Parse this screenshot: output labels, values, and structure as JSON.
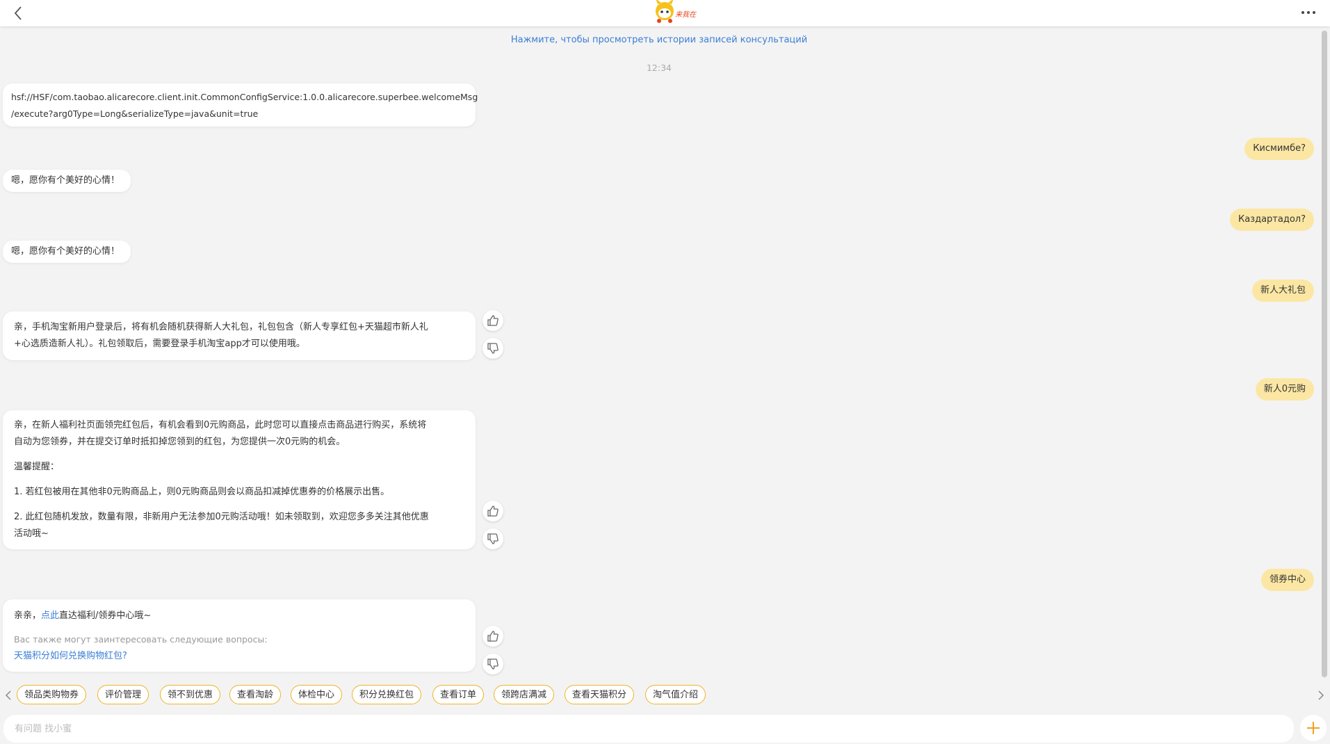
{
  "header": {
    "back_icon": "chevron-left-icon",
    "logo_text": "来我在",
    "more_icon": "more-horizontal-icon"
  },
  "chat": {
    "history_link": "Нажмите, чтобы просмотреть истории записей консультаций",
    "timestamp": "12:34",
    "messages": [
      {
        "from": "bot",
        "lines": [
          "hsf://HSF/com.taobao.alicarecore.client.init.CommonConfigService:1.0.0.alicarecore.superbee.welcomeMsg",
          "/execute?arg0Type=Long&serializeType=java&unit=true"
        ]
      },
      {
        "from": "user",
        "text": "Кисмимбе?"
      },
      {
        "from": "bot",
        "text": "嗯，愿你有个美好的心情！"
      },
      {
        "from": "user",
        "text": "Каздартадол?"
      },
      {
        "from": "bot",
        "text": "嗯，愿你有个美好的心情！"
      },
      {
        "from": "user",
        "text": "新人大礼包"
      },
      {
        "from": "bot",
        "lines": [
          "亲，手机淘宝新用户登录后，将有机会随机获得新人大礼包，礼包包含（新人专享红包+天猫超市新人礼",
          "+心选质造新人礼）。礼包领取后，需要登录手机淘宝app才可以使用哦。"
        ]
      },
      {
        "from": "user",
        "text": "新人0元购"
      },
      {
        "from": "bot",
        "para1": [
          "亲，在新人福利社页面领完红包后，有机会看到0元购商品，此时您可以直接点击商品进行购买，系统将",
          "自动为您领券，并在提交订单时抵扣掉您领到的红包，为您提供一次0元购的机会。"
        ],
        "para2": "温馨提醒：",
        "para3": "1. 若红包被用在其他非0元购商品上，则0元购商品则会以商品扣减掉优惠券的价格展示出售。",
        "para4": [
          "2. 此红包随机发放，数量有限，非新用户无法参加0元购活动哦！如未领取到，欢迎您多多关注其他优惠",
          "活动哦~"
        ]
      },
      {
        "from": "user",
        "text": "领券中心"
      },
      {
        "from": "bot",
        "prefix": "亲亲，",
        "link": "点此",
        "suffix": "直达福利/领券中心哦~",
        "suggest_title": "Вас также могут заинтересовать следующие вопросы:",
        "suggest_link": "天猫积分如何兑换购物红包?"
      }
    ],
    "thumb_up_icon": "thumbs-up-icon",
    "thumb_down_icon": "thumbs-down-icon"
  },
  "quick_replies": [
    "领品类购物券",
    "评价管理",
    "领不到优惠",
    "查看淘龄",
    "体检中心",
    "积分兑换红包",
    "查看订单",
    "领跨店满减",
    "查看天猫积分",
    "淘气值介绍"
  ],
  "input": {
    "placeholder": "有问题 找小蜜",
    "plus_icon": "plus-icon"
  },
  "colors": {
    "accent": "#f0b428",
    "user_bubble": "#fbe7a3",
    "link": "#3a7ed6"
  }
}
